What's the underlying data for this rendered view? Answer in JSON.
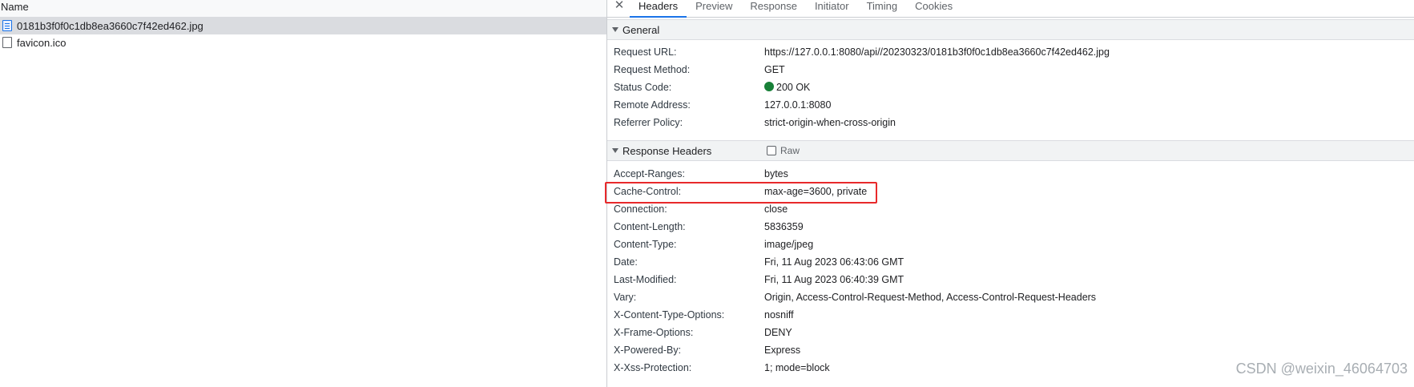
{
  "network_list": {
    "column_header": "Name",
    "files": [
      {
        "name": "0181b3f0f0c1db8ea3660c7f42ed462.jpg",
        "icon": "document-icon",
        "selected": true
      },
      {
        "name": "favicon.ico",
        "icon": "blank-file-icon",
        "selected": false
      }
    ]
  },
  "detail_tabs": [
    "Headers",
    "Preview",
    "Response",
    "Initiator",
    "Timing",
    "Cookies"
  ],
  "active_tab": "Headers",
  "close_glyph": "✕",
  "general": {
    "title": "General",
    "rows": [
      {
        "key": "Request URL:",
        "value": "https://127.0.0.1:8080/api//20230323/0181b3f0f0c1db8ea3660c7f42ed462.jpg"
      },
      {
        "key": "Request Method:",
        "value": "GET"
      },
      {
        "key": "Status Code:",
        "value": "200 OK"
      },
      {
        "key": "Remote Address:",
        "value": "127.0.0.1:8080"
      },
      {
        "key": "Referrer Policy:",
        "value": "strict-origin-when-cross-origin"
      }
    ]
  },
  "response_headers": {
    "title": "Response Headers",
    "raw_label": "Raw",
    "rows": [
      {
        "key": "Accept-Ranges:",
        "value": "bytes"
      },
      {
        "key": "Cache-Control:",
        "value": "max-age=3600, private"
      },
      {
        "key": "Connection:",
        "value": "close"
      },
      {
        "key": "Content-Length:",
        "value": "5836359"
      },
      {
        "key": "Content-Type:",
        "value": "image/jpeg"
      },
      {
        "key": "Date:",
        "value": "Fri, 11 Aug 2023 06:43:06 GMT"
      },
      {
        "key": "Last-Modified:",
        "value": "Fri, 11 Aug 2023 06:40:39 GMT"
      },
      {
        "key": "Vary:",
        "value": "Origin, Access-Control-Request-Method, Access-Control-Request-Headers"
      },
      {
        "key": "X-Content-Type-Options:",
        "value": "nosniff"
      },
      {
        "key": "X-Frame-Options:",
        "value": "DENY"
      },
      {
        "key": "X-Powered-By:",
        "value": "Express"
      },
      {
        "key": "X-Xss-Protection:",
        "value": "1; mode=block"
      }
    ]
  },
  "status_color": "#188038",
  "highlight_color": "#e8292b",
  "watermark": "CSDN @weixin_46064703"
}
